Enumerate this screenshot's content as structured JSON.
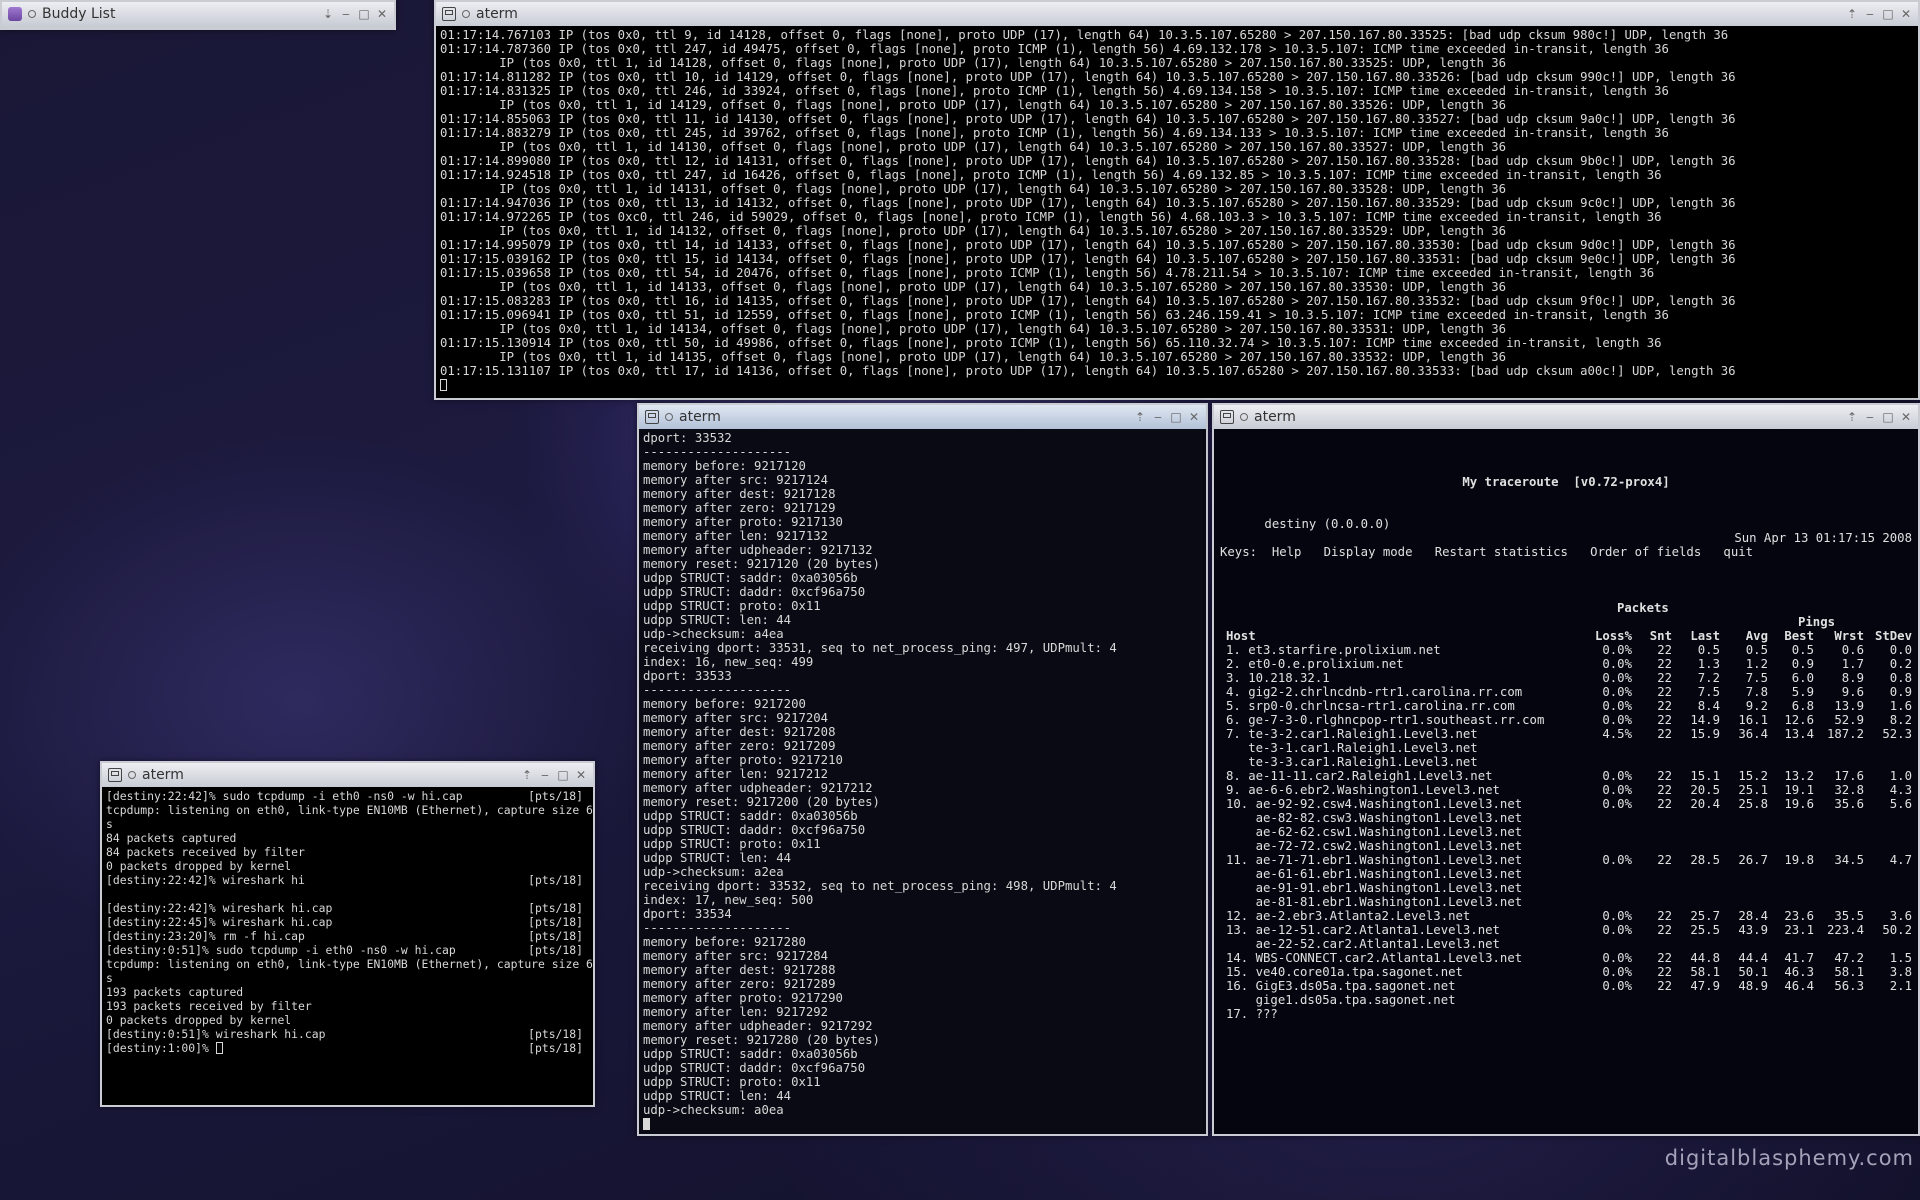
{
  "wallpaper": {
    "watermark": "digitalblasphemy.com"
  },
  "buddy_list": {
    "title": "Buddy List"
  },
  "top_term": {
    "title": "aterm",
    "lines": [
      "01:17:14.767103 IP (tos 0x0, ttl 9, id 14128, offset 0, flags [none], proto UDP (17), length 64) 10.3.5.107.65280 > 207.150.167.80.33525: [bad udp cksum 980c!] UDP, length 36",
      "01:17:14.787360 IP (tos 0x0, ttl 247, id 49475, offset 0, flags [none], proto ICMP (1), length 56) 4.69.132.178 > 10.3.5.107: ICMP time exceeded in-transit, length 36",
      "        IP (tos 0x0, ttl 1, id 14128, offset 0, flags [none], proto UDP (17), length 64) 10.3.5.107.65280 > 207.150.167.80.33525: UDP, length 36",
      "01:17:14.811282 IP (tos 0x0, ttl 10, id 14129, offset 0, flags [none], proto UDP (17), length 64) 10.3.5.107.65280 > 207.150.167.80.33526: [bad udp cksum 990c!] UDP, length 36",
      "01:17:14.831325 IP (tos 0x0, ttl 246, id 33924, offset 0, flags [none], proto ICMP (1), length 56) 4.69.134.158 > 10.3.5.107: ICMP time exceeded in-transit, length 36",
      "        IP (tos 0x0, ttl 1, id 14129, offset 0, flags [none], proto UDP (17), length 64) 10.3.5.107.65280 > 207.150.167.80.33526: UDP, length 36",
      "01:17:14.855063 IP (tos 0x0, ttl 11, id 14130, offset 0, flags [none], proto UDP (17), length 64) 10.3.5.107.65280 > 207.150.167.80.33527: [bad udp cksum 9a0c!] UDP, length 36",
      "01:17:14.883279 IP (tos 0x0, ttl 245, id 39762, offset 0, flags [none], proto ICMP (1), length 56) 4.69.134.133 > 10.3.5.107: ICMP time exceeded in-transit, length 36",
      "        IP (tos 0x0, ttl 1, id 14130, offset 0, flags [none], proto UDP (17), length 64) 10.3.5.107.65280 > 207.150.167.80.33527: UDP, length 36",
      "01:17:14.899080 IP (tos 0x0, ttl 12, id 14131, offset 0, flags [none], proto UDP (17), length 64) 10.3.5.107.65280 > 207.150.167.80.33528: [bad udp cksum 9b0c!] UDP, length 36",
      "01:17:14.924518 IP (tos 0x0, ttl 247, id 16426, offset 0, flags [none], proto ICMP (1), length 56) 4.69.132.85 > 10.3.5.107: ICMP time exceeded in-transit, length 36",
      "        IP (tos 0x0, ttl 1, id 14131, offset 0, flags [none], proto UDP (17), length 64) 10.3.5.107.65280 > 207.150.167.80.33528: UDP, length 36",
      "01:17:14.947036 IP (tos 0x0, ttl 13, id 14132, offset 0, flags [none], proto UDP (17), length 64) 10.3.5.107.65280 > 207.150.167.80.33529: [bad udp cksum 9c0c!] UDP, length 36",
      "01:17:14.972265 IP (tos 0xc0, ttl 246, id 59029, offset 0, flags [none], proto ICMP (1), length 56) 4.68.103.3 > 10.3.5.107: ICMP time exceeded in-transit, length 36",
      "        IP (tos 0x0, ttl 1, id 14132, offset 0, flags [none], proto UDP (17), length 64) 10.3.5.107.65280 > 207.150.167.80.33529: UDP, length 36",
      "01:17:14.995079 IP (tos 0x0, ttl 14, id 14133, offset 0, flags [none], proto UDP (17), length 64) 10.3.5.107.65280 > 207.150.167.80.33530: [bad udp cksum 9d0c!] UDP, length 36",
      "01:17:15.039162 IP (tos 0x0, ttl 15, id 14134, offset 0, flags [none], proto UDP (17), length 64) 10.3.5.107.65280 > 207.150.167.80.33531: [bad udp cksum 9e0c!] UDP, length 36",
      "01:17:15.039658 IP (tos 0x0, ttl 54, id 20476, offset 0, flags [none], proto ICMP (1), length 56) 4.78.211.54 > 10.3.5.107: ICMP time exceeded in-transit, length 36",
      "        IP (tos 0x0, ttl 1, id 14133, offset 0, flags [none], proto UDP (17), length 64) 10.3.5.107.65280 > 207.150.167.80.33530: UDP, length 36",
      "01:17:15.083283 IP (tos 0x0, ttl 16, id 14135, offset 0, flags [none], proto UDP (17), length 64) 10.3.5.107.65280 > 207.150.167.80.33532: [bad udp cksum 9f0c!] UDP, length 36",
      "01:17:15.096941 IP (tos 0x0, ttl 51, id 12559, offset 0, flags [none], proto ICMP (1), length 56) 63.246.159.41 > 10.3.5.107: ICMP time exceeded in-transit, length 36",
      "        IP (tos 0x0, ttl 1, id 14134, offset 0, flags [none], proto UDP (17), length 64) 10.3.5.107.65280 > 207.150.167.80.33531: UDP, length 36",
      "01:17:15.130914 IP (tos 0x0, ttl 50, id 49986, offset 0, flags [none], proto ICMP (1), length 56) 65.110.32.74 > 10.3.5.107: ICMP time exceeded in-transit, length 36",
      "        IP (tos 0x0, ttl 1, id 14135, offset 0, flags [none], proto UDP (17), length 64) 10.3.5.107.65280 > 207.150.167.80.33532: UDP, length 36",
      "01:17:15.131107 IP (tos 0x0, ttl 17, id 14136, offset 0, flags [none], proto UDP (17), length 64) 10.3.5.107.65280 > 207.150.167.80.33533: [bad udp cksum a00c!] UDP, length 36"
    ]
  },
  "left_term": {
    "title": "aterm",
    "rows": [
      {
        "l": "[destiny:22:42]% sudo tcpdump -i eth0 -ns0 -w hi.cap",
        "r": "[pts/18]"
      },
      {
        "l": "tcpdump: listening on eth0, link-type EN10MB (Ethernet), capture size 65535 byte",
        "r": ""
      },
      {
        "l": "s",
        "r": ""
      },
      {
        "l": "84 packets captured",
        "r": ""
      },
      {
        "l": "84 packets received by filter",
        "r": ""
      },
      {
        "l": "0 packets dropped by kernel",
        "r": ""
      },
      {
        "l": "[destiny:22:42]% wireshark hi",
        "r": "[pts/18]"
      },
      {
        "l": "",
        "r": ""
      },
      {
        "l": "[destiny:22:42]% wireshark hi.cap",
        "r": "[pts/18]"
      },
      {
        "l": "[destiny:22:45]% wireshark hi.cap",
        "r": "[pts/18]"
      },
      {
        "l": "[destiny:23:20]% rm -f hi.cap",
        "r": "[pts/18]"
      },
      {
        "l": "[destiny:0:51]% sudo tcpdump -i eth0 -ns0 -w hi.cap",
        "r": "[pts/18]"
      },
      {
        "l": "tcpdump: listening on eth0, link-type EN10MB (Ethernet), capture size 65535 byte",
        "r": ""
      },
      {
        "l": "s",
        "r": ""
      },
      {
        "l": "193 packets captured",
        "r": ""
      },
      {
        "l": "193 packets received by filter",
        "r": ""
      },
      {
        "l": "0 packets dropped by kernel",
        "r": ""
      },
      {
        "l": "[destiny:0:51]% wireshark hi.cap",
        "r": "[pts/18]"
      },
      {
        "l": "[destiny:1:00]% ",
        "r": "[pts/18]"
      }
    ]
  },
  "mid_term": {
    "title": "aterm",
    "lines": [
      "dport: 33532",
      "--------------------",
      "memory before: 9217120",
      "memory after src: 9217124",
      "memory after dest: 9217128",
      "memory after zero: 9217129",
      "memory after proto: 9217130",
      "memory after len: 9217132",
      "memory after udpheader: 9217132",
      "memory reset: 9217120 (20 bytes)",
      "udpp STRUCT: saddr: 0xa03056b",
      "udpp STRUCT: daddr: 0xcf96a750",
      "udpp STRUCT: proto: 0x11",
      "udpp STRUCT: len: 44",
      "udp->checksum: a4ea",
      "receiving dport: 33531, seq to net_process_ping: 497, UDPmult: 4",
      "index: 16, new_seq: 499",
      "dport: 33533",
      "--------------------",
      "memory before: 9217200",
      "memory after src: 9217204",
      "memory after dest: 9217208",
      "memory after zero: 9217209",
      "memory after proto: 9217210",
      "memory after len: 9217212",
      "memory after udpheader: 9217212",
      "memory reset: 9217200 (20 bytes)",
      "udpp STRUCT: saddr: 0xa03056b",
      "udpp STRUCT: daddr: 0xcf96a750",
      "udpp STRUCT: proto: 0x11",
      "udpp STRUCT: len: 44",
      "udp->checksum: a2ea",
      "receiving dport: 33532, seq to net_process_ping: 498, UDPmult: 4",
      "index: 17, new_seq: 500",
      "dport: 33534",
      "--------------------",
      "memory before: 9217280",
      "memory after src: 9217284",
      "memory after dest: 9217288",
      "memory after zero: 9217289",
      "memory after proto: 9217290",
      "memory after len: 9217292",
      "memory after udpheader: 9217292",
      "memory reset: 9217280 (20 bytes)",
      "udpp STRUCT: saddr: 0xa03056b",
      "udpp STRUCT: daddr: 0xcf96a750",
      "udpp STRUCT: proto: 0x11",
      "udpp STRUCT: len: 44",
      "udp->checksum: a0ea"
    ]
  },
  "mtr_term": {
    "title": "aterm",
    "app_title": "My traceroute  [v0.72-prox4]",
    "host_line": "destiny (0.0.0.0)",
    "datetime": "Sun Apr 13 01:17:15 2008",
    "keys_line": "Keys:  Help   Display mode   Restart statistics   Order of fields   quit",
    "group_packets": "Packets",
    "group_pings": "Pings",
    "columns": [
      "Host",
      "Loss%",
      "Snt",
      "Last",
      "Avg",
      "Best",
      "Wrst",
      "StDev"
    ],
    "rows": [
      [
        "1. et3.starfire.prolixium.net",
        "0.0%",
        "22",
        "0.5",
        "0.5",
        "0.5",
        "0.6",
        "0.0"
      ],
      [
        "2. et0-0.e.prolixium.net",
        "0.0%",
        "22",
        "1.3",
        "1.2",
        "0.9",
        "1.7",
        "0.2"
      ],
      [
        "3. 10.218.32.1",
        "0.0%",
        "22",
        "7.2",
        "7.5",
        "6.0",
        "8.9",
        "0.8"
      ],
      [
        "4. gig2-2.chrlncdnb-rtr1.carolina.rr.com",
        "0.0%",
        "22",
        "7.5",
        "7.8",
        "5.9",
        "9.6",
        "0.9"
      ],
      [
        "5. srp0-0.chrlncsa-rtr1.carolina.rr.com",
        "0.0%",
        "22",
        "8.4",
        "9.2",
        "6.8",
        "13.9",
        "1.6"
      ],
      [
        "6. ge-7-3-0.rlghncpop-rtr1.southeast.rr.com",
        "0.0%",
        "22",
        "14.9",
        "16.1",
        "12.6",
        "52.9",
        "8.2"
      ],
      [
        "7. te-3-2.car1.Raleigh1.Level3.net",
        "4.5%",
        "22",
        "15.9",
        "36.4",
        "13.4",
        "187.2",
        "52.3"
      ],
      [
        "   te-3-1.car1.Raleigh1.Level3.net",
        "",
        "",
        "",
        "",
        "",
        "",
        ""
      ],
      [
        "   te-3-3.car1.Raleigh1.Level3.net",
        "",
        "",
        "",
        "",
        "",
        "",
        ""
      ],
      [
        "8. ae-11-11.car2.Raleigh1.Level3.net",
        "0.0%",
        "22",
        "15.1",
        "15.2",
        "13.2",
        "17.6",
        "1.0"
      ],
      [
        "9. ae-6-6.ebr2.Washington1.Level3.net",
        "0.0%",
        "22",
        "20.5",
        "25.1",
        "19.1",
        "32.8",
        "4.3"
      ],
      [
        "10. ae-92-92.csw4.Washington1.Level3.net",
        "0.0%",
        "22",
        "20.4",
        "25.8",
        "19.6",
        "35.6",
        "5.6"
      ],
      [
        "    ae-82-82.csw3.Washington1.Level3.net",
        "",
        "",
        "",
        "",
        "",
        "",
        ""
      ],
      [
        "    ae-62-62.csw1.Washington1.Level3.net",
        "",
        "",
        "",
        "",
        "",
        "",
        ""
      ],
      [
        "    ae-72-72.csw2.Washington1.Level3.net",
        "",
        "",
        "",
        "",
        "",
        "",
        ""
      ],
      [
        "11. ae-71-71.ebr1.Washington1.Level3.net",
        "0.0%",
        "22",
        "28.5",
        "26.7",
        "19.8",
        "34.5",
        "4.7"
      ],
      [
        "    ae-61-61.ebr1.Washington1.Level3.net",
        "",
        "",
        "",
        "",
        "",
        "",
        ""
      ],
      [
        "    ae-91-91.ebr1.Washington1.Level3.net",
        "",
        "",
        "",
        "",
        "",
        "",
        ""
      ],
      [
        "    ae-81-81.ebr1.Washington1.Level3.net",
        "",
        "",
        "",
        "",
        "",
        "",
        ""
      ],
      [
        "12. ae-2.ebr3.Atlanta2.Level3.net",
        "0.0%",
        "22",
        "25.7",
        "28.4",
        "23.6",
        "35.5",
        "3.6"
      ],
      [
        "13. ae-12-51.car2.Atlanta1.Level3.net",
        "0.0%",
        "22",
        "25.5",
        "43.9",
        "23.1",
        "223.4",
        "50.2"
      ],
      [
        "    ae-22-52.car2.Atlanta1.Level3.net",
        "",
        "",
        "",
        "",
        "",
        "",
        ""
      ],
      [
        "14. WBS-CONNECT.car2.Atlanta1.Level3.net",
        "0.0%",
        "22",
        "44.8",
        "44.4",
        "41.7",
        "47.2",
        "1.5"
      ],
      [
        "15. ve40.core01a.tpa.sagonet.net",
        "0.0%",
        "22",
        "58.1",
        "50.1",
        "46.3",
        "58.1",
        "3.8"
      ],
      [
        "16. GigE3.ds05a.tpa.sagonet.net",
        "0.0%",
        "22",
        "47.9",
        "48.9",
        "46.4",
        "56.3",
        "2.1"
      ],
      [
        "    gige1.ds05a.tpa.sagonet.net",
        "",
        "",
        "",
        "",
        "",
        "",
        ""
      ],
      [
        "17. ???",
        "",
        "",
        "",
        "",
        "",
        "",
        ""
      ]
    ]
  }
}
